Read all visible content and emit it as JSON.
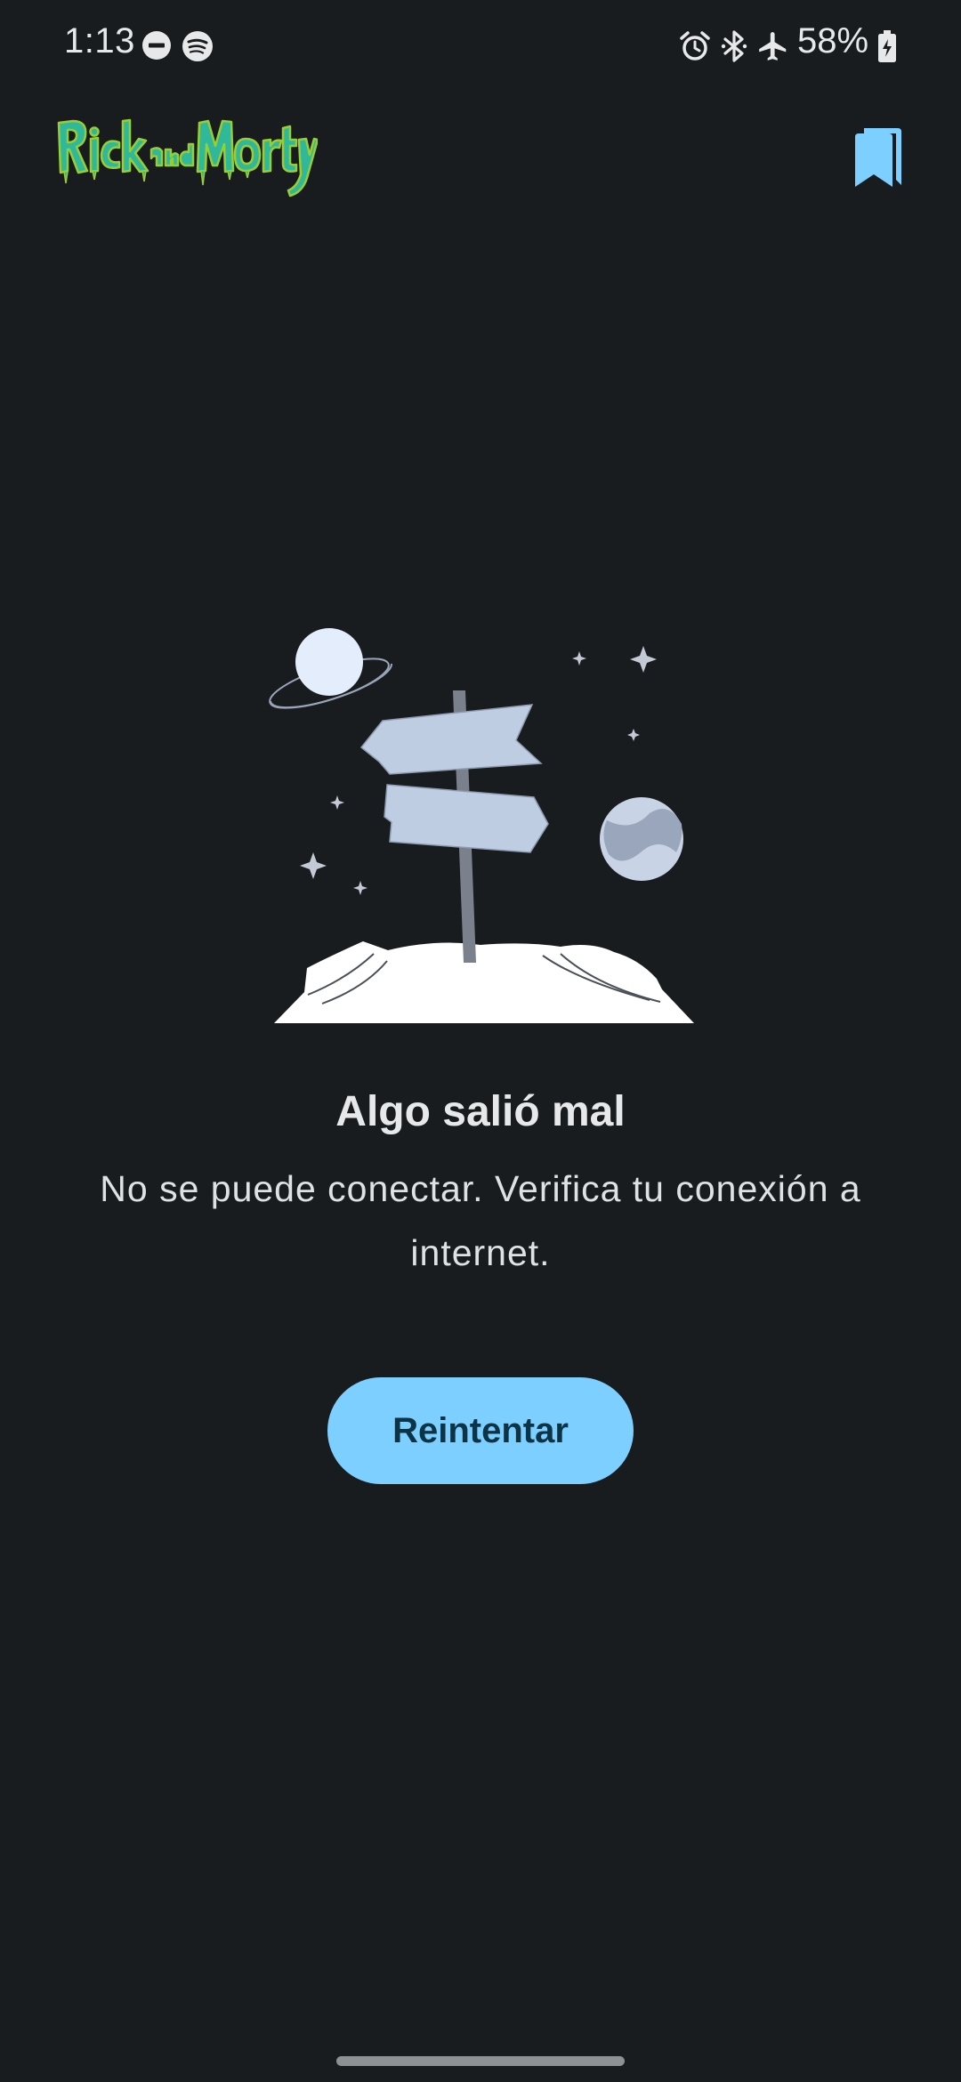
{
  "status_bar": {
    "time": "1:13",
    "battery": "58%",
    "left_icons": [
      "do-not-disturb-icon",
      "spotify-icon"
    ],
    "right_icons": [
      "alarm-icon",
      "bluetooth-icon",
      "airplane-mode-icon",
      "battery-charging-icon"
    ]
  },
  "app_bar": {
    "logo_text": "Rick and Morty",
    "bookmarks_icon": "bookmarks-icon"
  },
  "error": {
    "title": "Algo salió mal",
    "message": "No se puede conectar. Verifica tu conexión a internet.",
    "retry_label": "Reintentar"
  },
  "colors": {
    "background": "#191c1f",
    "accent": "#7dcfff",
    "button_text": "#0d3346",
    "logo_green": "#2fb89a",
    "logo_outline": "#9acd32"
  }
}
